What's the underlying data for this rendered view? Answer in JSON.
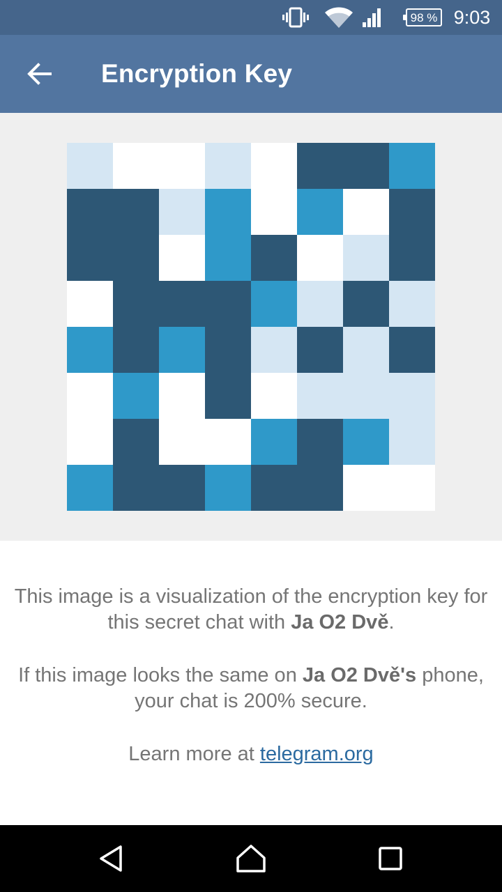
{
  "status_bar": {
    "icons": [
      "vibrate-icon",
      "wifi-icon",
      "signal-icon",
      "battery-icon"
    ],
    "battery": "98 %",
    "time": "9:03"
  },
  "toolbar": {
    "back_icon": "arrow-back-icon",
    "title": "Encryption Key"
  },
  "key": {
    "colors": {
      "0": "#ffffff",
      "1": "#d5e6f3",
      "2": "#2d5775",
      "3": "#2f99c9"
    },
    "grid": [
      [
        1,
        0,
        0,
        1,
        0,
        2,
        2,
        3
      ],
      [
        2,
        2,
        1,
        3,
        0,
        3,
        0,
        2
      ],
      [
        2,
        2,
        0,
        3,
        2,
        0,
        1,
        2
      ],
      [
        0,
        2,
        2,
        2,
        3,
        1,
        2,
        1
      ],
      [
        3,
        2,
        3,
        2,
        1,
        2,
        1,
        2
      ],
      [
        0,
        3,
        0,
        2,
        0,
        1,
        1,
        1
      ],
      [
        0,
        2,
        0,
        0,
        3,
        2,
        3,
        1
      ],
      [
        3,
        2,
        2,
        3,
        2,
        2,
        0,
        0
      ]
    ]
  },
  "info": {
    "p1_text": "This image is a visualization of the encryption key for this secret chat with ",
    "p1_name": "Ja O2 Dvě",
    "p1_end": ".",
    "p2_text": "If this image looks the same on ",
    "p2_name": "Ja O2 Dvě's",
    "p2_end": " phone, your chat is 200% secure.",
    "p3_text": "Learn more at ",
    "p3_link": "telegram.org"
  },
  "nav": {
    "back": "nav-back-icon",
    "home": "nav-home-icon",
    "recents": "nav-recents-icon"
  }
}
